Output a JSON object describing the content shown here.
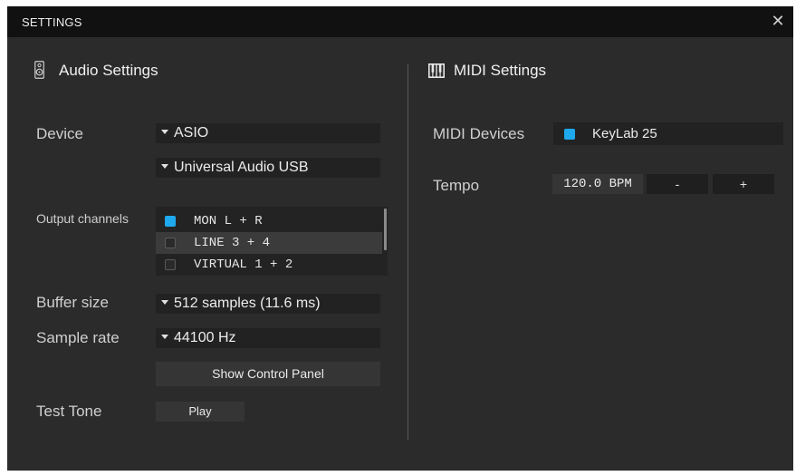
{
  "window": {
    "title": "SETTINGS",
    "close_label": "✕"
  },
  "audio": {
    "title": "Audio Settings",
    "device_label": "Device",
    "device_value": "ASIO",
    "interface_value": "Universal Audio USB",
    "output_channels_label": "Output channels",
    "channels": [
      {
        "label": "MON L + R",
        "checked": true
      },
      {
        "label": "LINE 3 + 4",
        "checked": false
      },
      {
        "label": "VIRTUAL 1 + 2",
        "checked": false
      }
    ],
    "buffer_label": "Buffer size",
    "buffer_value": "512 samples (11.6 ms)",
    "sample_rate_label": "Sample rate",
    "sample_rate_value": "44100 Hz",
    "control_panel_button": "Show Control Panel",
    "test_tone_label": "Test Tone",
    "play_button": "Play"
  },
  "midi": {
    "title": "MIDI Settings",
    "devices_label": "MIDI Devices",
    "device_name": "KeyLab 25",
    "device_checked": true,
    "tempo_label": "Tempo",
    "tempo_value": "120.0 BPM",
    "minus_label": "-",
    "plus_label": "+"
  },
  "colors": {
    "accent": "#1ea9ee",
    "window_bg": "#2b2b2b",
    "titlebar_bg": "#111111"
  },
  "icons": [
    "speaker-icon",
    "piano-keys-icon",
    "close-icon",
    "caret-down-icon",
    "checkbox-icon"
  ]
}
